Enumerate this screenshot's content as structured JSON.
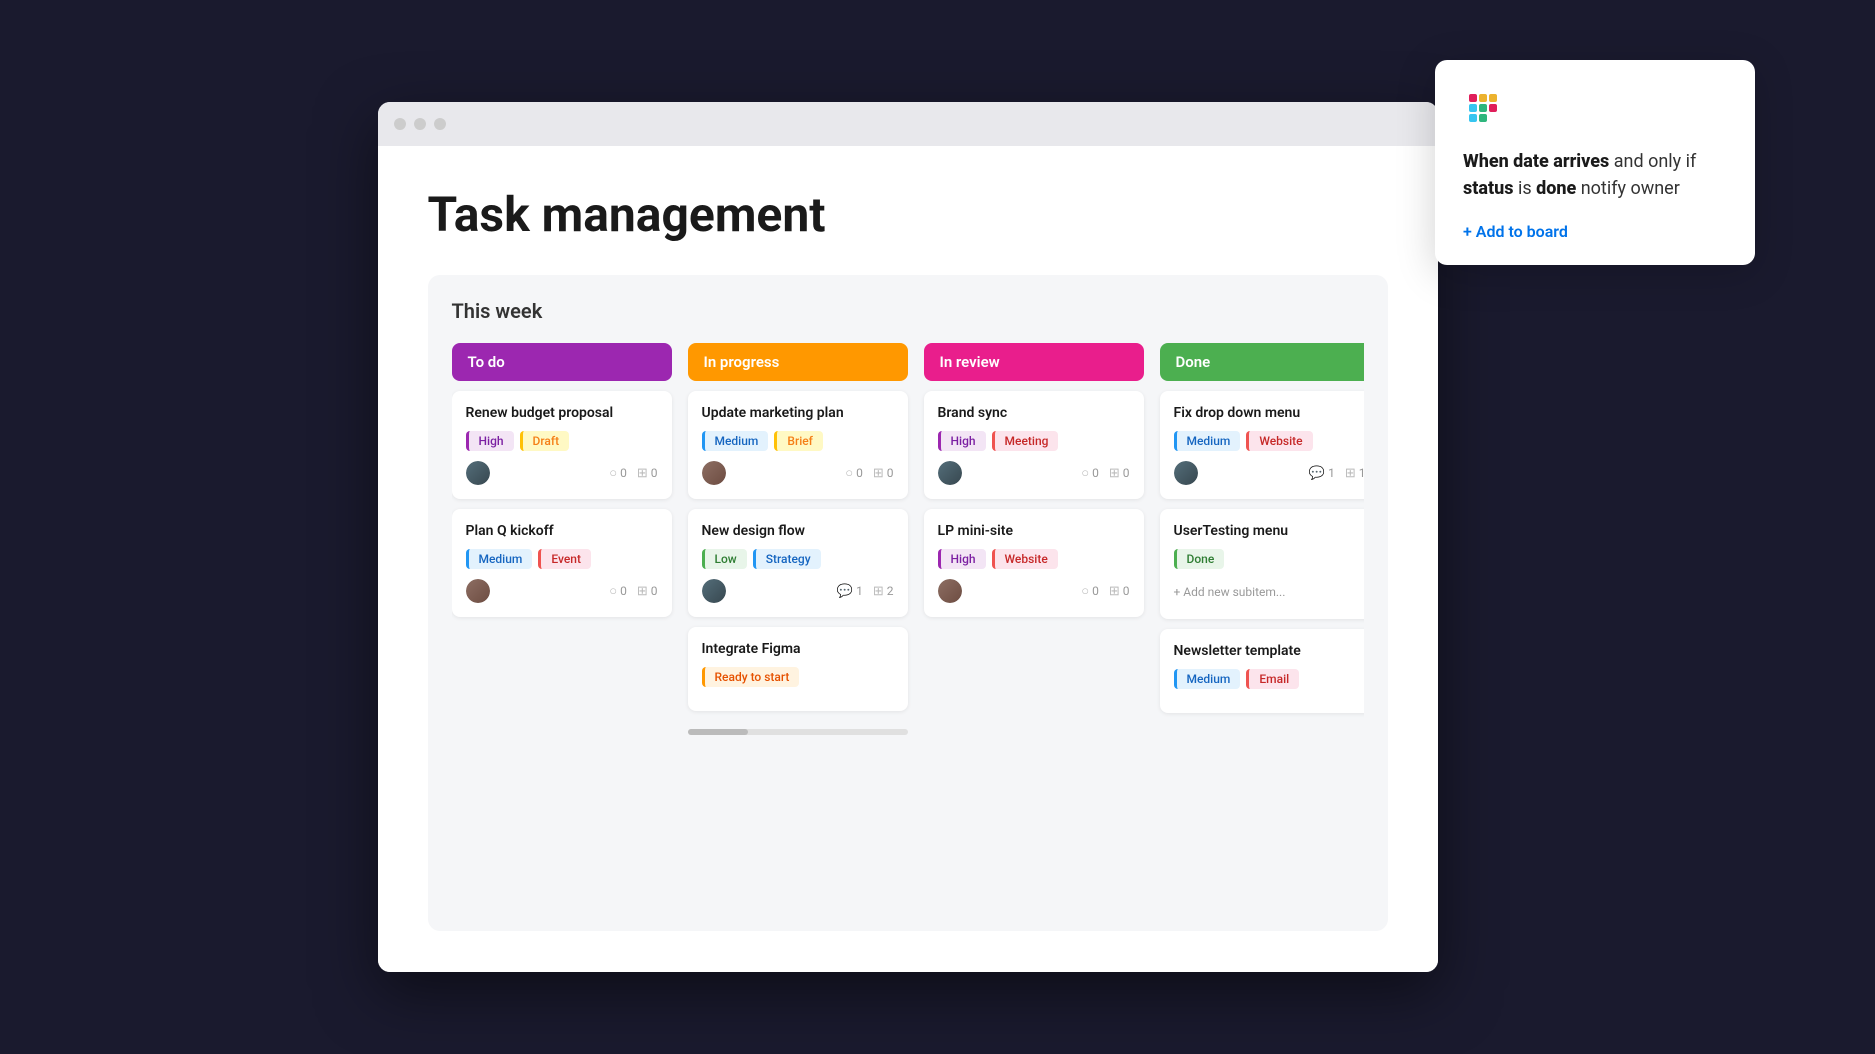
{
  "browser": {
    "dots": [
      "red",
      "yellow",
      "green"
    ]
  },
  "page": {
    "title": "Task management"
  },
  "board": {
    "section_label": "This  week",
    "columns": [
      {
        "id": "todo",
        "label": "To do",
        "color": "#9c27b0",
        "cards": [
          {
            "title": "Renew budget proposal",
            "tags": [
              {
                "label": "High",
                "type": "high"
              },
              {
                "label": "Draft",
                "type": "draft"
              }
            ],
            "avatar_style": "dark",
            "comments": "0",
            "subitems": "0"
          },
          {
            "title": "Plan Q kickoff",
            "tags": [
              {
                "label": "Medium",
                "type": "medium"
              },
              {
                "label": "Event",
                "type": "event"
              }
            ],
            "avatar_style": "brown",
            "comments": "0",
            "subitems": "0"
          }
        ]
      },
      {
        "id": "inprogress",
        "label": "In progress",
        "color": "#ff9800",
        "cards": [
          {
            "title": "Update marketing plan",
            "tags": [
              {
                "label": "Medium",
                "type": "medium"
              },
              {
                "label": "Brief",
                "type": "brief"
              }
            ],
            "avatar_style": "brown",
            "comments": "0",
            "subitems": "0"
          },
          {
            "title": "New design flow",
            "tags": [
              {
                "label": "Low",
                "type": "low"
              },
              {
                "label": "Strategy",
                "type": "strategy"
              }
            ],
            "avatar_style": "dark",
            "comments": "1",
            "subitems": "2"
          },
          {
            "title": "Integrate Figma",
            "tags": [
              {
                "label": "Ready to start",
                "type": "ready"
              }
            ],
            "avatar_style": null,
            "comments": null,
            "subitems": null
          }
        ]
      },
      {
        "id": "inreview",
        "label": "In review",
        "color": "#e91e8c",
        "cards": [
          {
            "title": "Brand sync",
            "tags": [
              {
                "label": "High",
                "type": "high"
              },
              {
                "label": "Meeting",
                "type": "meeting"
              }
            ],
            "avatar_style": "dark",
            "comments": "0",
            "subitems": "0"
          },
          {
            "title": "LP mini-site",
            "tags": [
              {
                "label": "High",
                "type": "high"
              },
              {
                "label": "Website",
                "type": "website"
              }
            ],
            "avatar_style": "brown",
            "comments": "0",
            "subitems": "0"
          }
        ]
      },
      {
        "id": "done",
        "label": "Done",
        "color": "#4caf50",
        "cards": [
          {
            "title": "Fix drop down menu",
            "tags": [
              {
                "label": "Medium",
                "type": "medium"
              },
              {
                "label": "Website",
                "type": "website"
              }
            ],
            "avatar_style": "dark",
            "comments": "1",
            "subitems": "1"
          },
          {
            "title": "UserTesting menu",
            "tags": [
              {
                "label": "Done",
                "type": "done"
              }
            ],
            "avatar_style": null,
            "has_subitem_add": true,
            "subitem_add_label": "+ Add new subitem...",
            "comments": null,
            "subitems": null
          },
          {
            "title": "Newsletter template",
            "tags": [
              {
                "label": "Medium",
                "type": "medium"
              },
              {
                "label": "Email",
                "type": "email"
              }
            ],
            "avatar_style": null,
            "comments": null,
            "subitems": null
          }
        ]
      }
    ]
  },
  "popup": {
    "description_part1": "When date arrives",
    "description_part2": " and only if ",
    "description_part3": "status",
    "description_part4": " is ",
    "description_part5": "done",
    "description_part6": " notify owner",
    "add_to_board_label": "+ Add to board"
  }
}
